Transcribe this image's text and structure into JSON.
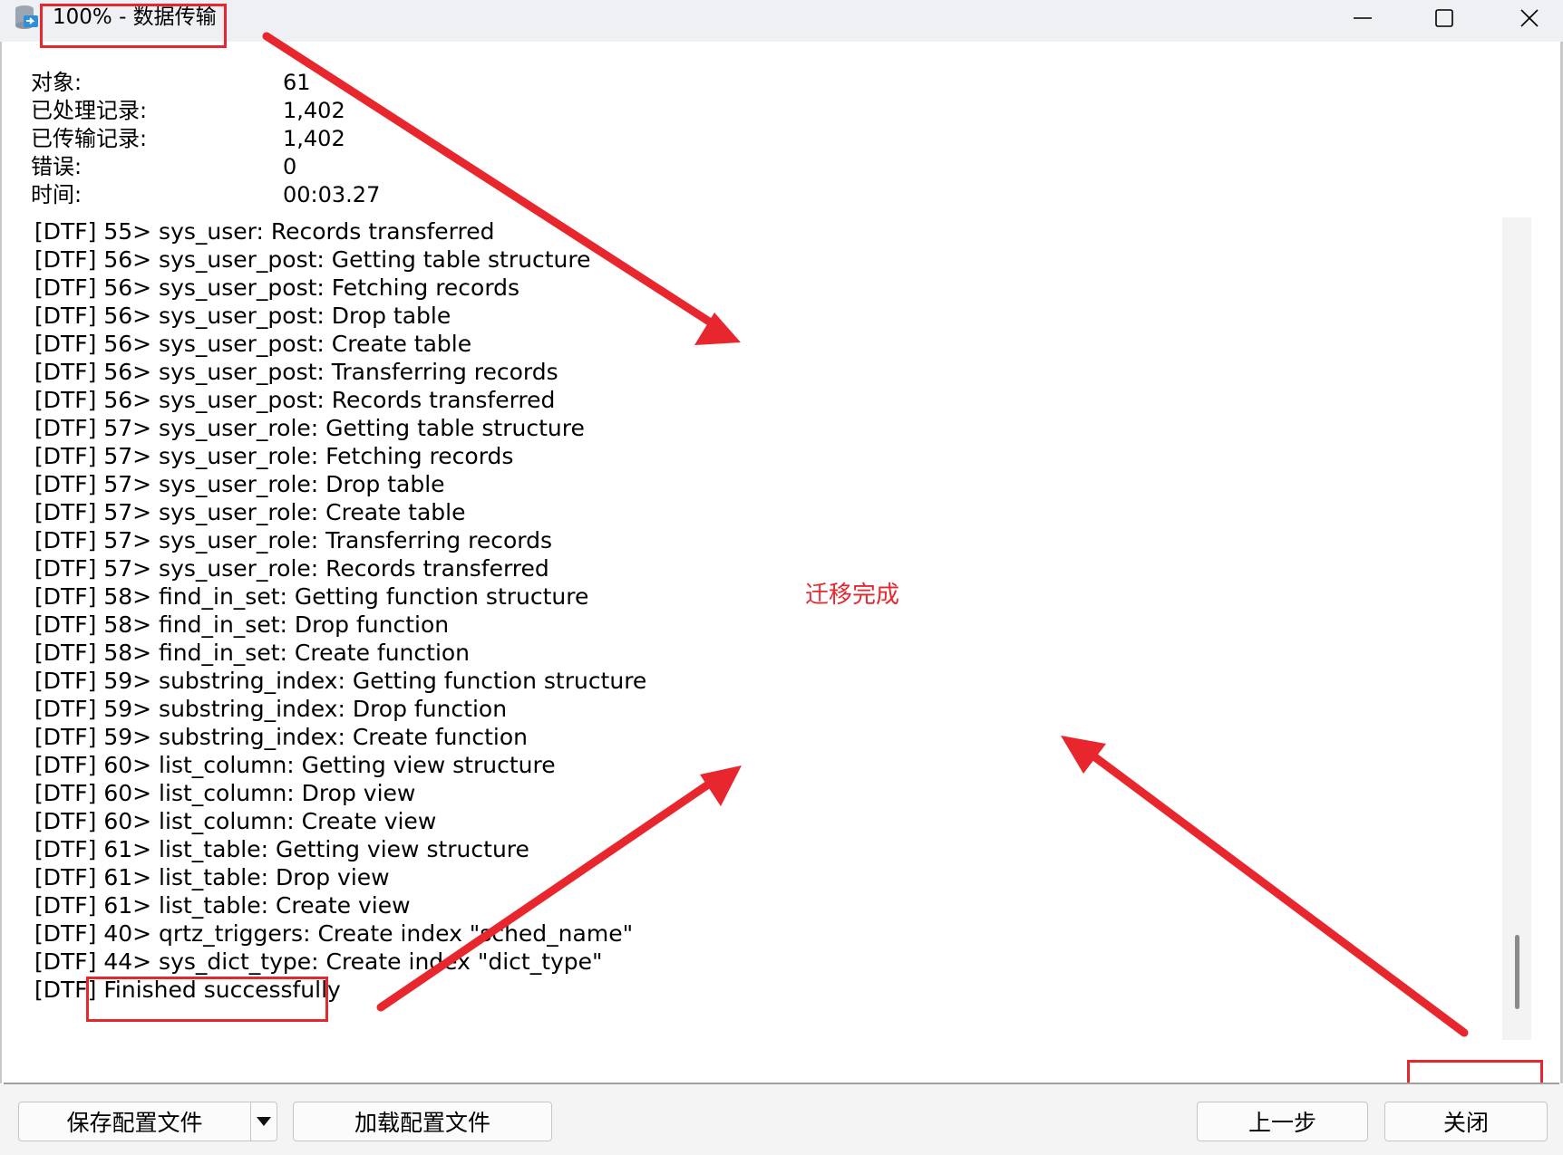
{
  "window": {
    "title": "100% - 数据传输",
    "app_icon": "database-transfer-icon",
    "controls": {
      "minimize_icon": "minimize-icon",
      "maximize_icon": "maximize-icon",
      "close_icon": "close-icon"
    }
  },
  "stats": [
    {
      "label": "对象:",
      "value": "61"
    },
    {
      "label": "已处理记录:",
      "value": "1,402"
    },
    {
      "label": "已传输记录:",
      "value": "1,402"
    },
    {
      "label": "错误:",
      "value": "0"
    },
    {
      "label": "时间:",
      "value": "00:03.27"
    }
  ],
  "log": [
    "[DTF] 55> sys_user: Records transferred",
    "[DTF] 56> sys_user_post: Getting table structure",
    "[DTF] 56> sys_user_post: Fetching records",
    "[DTF] 56> sys_user_post: Drop table",
    "[DTF] 56> sys_user_post: Create table",
    "[DTF] 56> sys_user_post: Transferring records",
    "[DTF] 56> sys_user_post: Records transferred",
    "[DTF] 57> sys_user_role: Getting table structure",
    "[DTF] 57> sys_user_role: Fetching records",
    "[DTF] 57> sys_user_role: Drop table",
    "[DTF] 57> sys_user_role: Create table",
    "[DTF] 57> sys_user_role: Transferring records",
    "[DTF] 57> sys_user_role: Records transferred",
    "[DTF] 58> find_in_set: Getting function structure",
    "[DTF] 58> find_in_set: Drop function",
    "[DTF] 58> find_in_set: Create function",
    "[DTF] 59> substring_index: Getting function structure",
    "[DTF] 59> substring_index: Drop function",
    "[DTF] 59> substring_index: Create function",
    "[DTF] 60> list_column: Getting view structure",
    "[DTF] 60> list_column: Drop view",
    "[DTF] 60> list_column: Create view",
    "[DTF] 61> list_table: Getting view structure",
    "[DTF] 61> list_table: Drop view",
    "[DTF] 61> list_table: Create view",
    "[DTF] 40> qrtz_triggers: Create index \"sched_name\"",
    "[DTF] 44> sys_dict_type: Create index \"dict_type\"",
    "[DTF] Finished successfully"
  ],
  "annotation": {
    "text": "迁移完成",
    "color": "#e8262d"
  },
  "buttons": {
    "save_config": "保存配置文件",
    "save_dropdown_icon": "caret-down-icon",
    "load_config": "加载配置文件",
    "back": "上一步",
    "close": "关闭"
  }
}
